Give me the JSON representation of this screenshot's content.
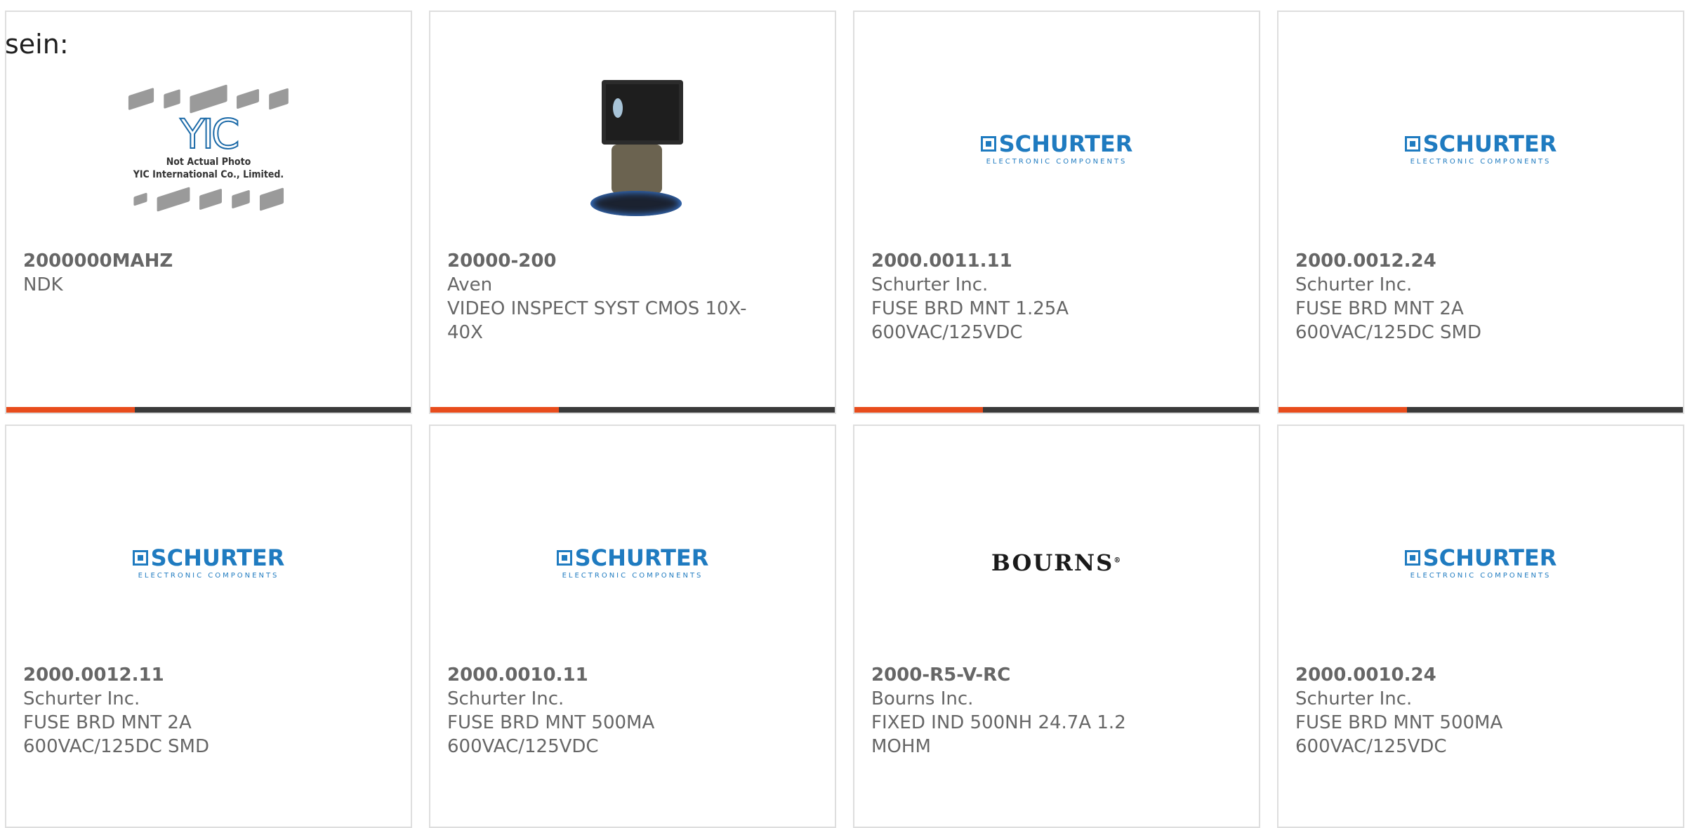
{
  "intro_text": "sein:",
  "products": [
    {
      "part_number": "2000000MAHZ",
      "manufacturer": "NDK",
      "description": "",
      "image": "yic-not-actual-photo",
      "image_caption_line1": "Not Actual Photo",
      "image_caption_line2": "YIC International Co., Limited.",
      "image_logo": "YIC"
    },
    {
      "part_number": "20000-200",
      "manufacturer": "Aven",
      "description": "VIDEO INSPECT SYST CMOS 10X-40X",
      "image": "video-inspection-system"
    },
    {
      "part_number": "2000.0011.11",
      "manufacturer": "Schurter Inc.",
      "description": "FUSE BRD MNT 1.25A 600VAC/125VDC",
      "image": "schurter-logo"
    },
    {
      "part_number": "2000.0012.24",
      "manufacturer": "Schurter Inc.",
      "description": "FUSE BRD MNT 2A 600VAC/125DC SMD",
      "image": "schurter-logo"
    },
    {
      "part_number": "2000.0012.11",
      "manufacturer": "Schurter Inc.",
      "description": "FUSE BRD MNT 2A 600VAC/125DC SMD",
      "image": "schurter-logo"
    },
    {
      "part_number": "2000.0010.11",
      "manufacturer": "Schurter Inc.",
      "description": "FUSE BRD MNT 500MA 600VAC/125VDC",
      "image": "schurter-logo"
    },
    {
      "part_number": "2000-R5-V-RC",
      "manufacturer": "Bourns Inc.",
      "description": "FIXED IND 500NH 24.7A 1.2 MOHM",
      "image": "bourns-logo"
    },
    {
      "part_number": "2000.0010.24",
      "manufacturer": "Schurter Inc.",
      "description": "FUSE BRD MNT 500MA 600VAC/125VDC",
      "image": "schurter-logo"
    }
  ],
  "logos": {
    "schurter_name": "SCHURTER",
    "schurter_tagline": "ELECTRONIC COMPONENTS",
    "bourns_name": "BOURNS"
  },
  "colors": {
    "accent_bar": "#e84c1c",
    "dark_bar": "#3a3a3a",
    "schurter_blue": "#1f7bc0",
    "card_border": "#dedede",
    "text": "#666666"
  }
}
